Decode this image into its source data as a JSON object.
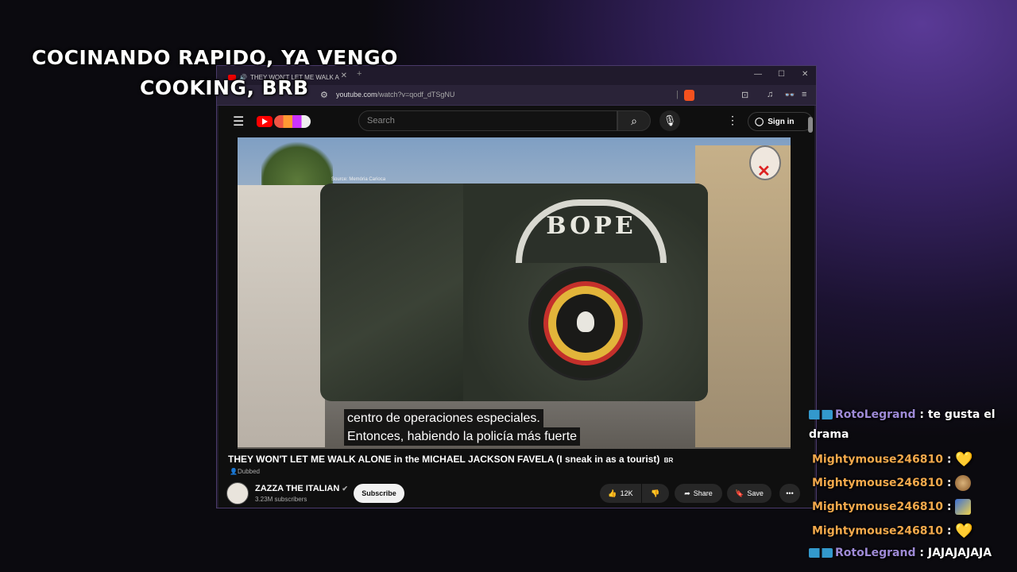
{
  "overlay": {
    "line1": "COCINANDO RAPIDO, YA VENGO",
    "line2": "COOKING, BRB"
  },
  "browser": {
    "tab_title": "THEY WON'T LET ME WALK A",
    "url_host": "youtube.com",
    "url_path": "/watch?v=qodf_dTSgNU"
  },
  "youtube": {
    "search_placeholder": "Search",
    "sign_in": "Sign in",
    "watermark_source": "Source: Memória Carioca",
    "subtitle_line1": "centro de operaciones especiales.",
    "subtitle_line2": "Entonces, habiendo la policía más fuerte",
    "patch_text": "BOPE",
    "video_title": "THEY WON'T LET ME WALK ALONE in the MICHAEL JACKSON FAVELA (I sneak in as a tourist)",
    "title_suffix": "BR",
    "dubbed": "Dubbed",
    "channel_name": "ZAZZA THE ITALIAN",
    "channel_subs": "3.23M subscribers",
    "subscribe": "Subscribe",
    "likes": "12K",
    "share": "Share",
    "save": "Save"
  },
  "chat": [
    {
      "user": "RotoLegrand",
      "text": "te gusta el",
      "text2": "drama",
      "color": "#9e8ad6"
    },
    {
      "user": "Mightymouse246810",
      "text": "",
      "emote": "yellow-heart",
      "color": "#f3a94c"
    },
    {
      "user": "Mightymouse246810",
      "text": "",
      "emote": "cartoon-emote",
      "color": "#f3a94c"
    },
    {
      "user": "Mightymouse246810",
      "text": "",
      "emote": "cartoon-emote-2",
      "color": "#f3a94c"
    },
    {
      "user": "Mightymouse246810",
      "text": "",
      "emote": "yellow-heart",
      "color": "#f3a94c"
    },
    {
      "user": "RotoLegrand",
      "text": "JAJAJAJAJA",
      "color": "#9e8ad6"
    }
  ]
}
